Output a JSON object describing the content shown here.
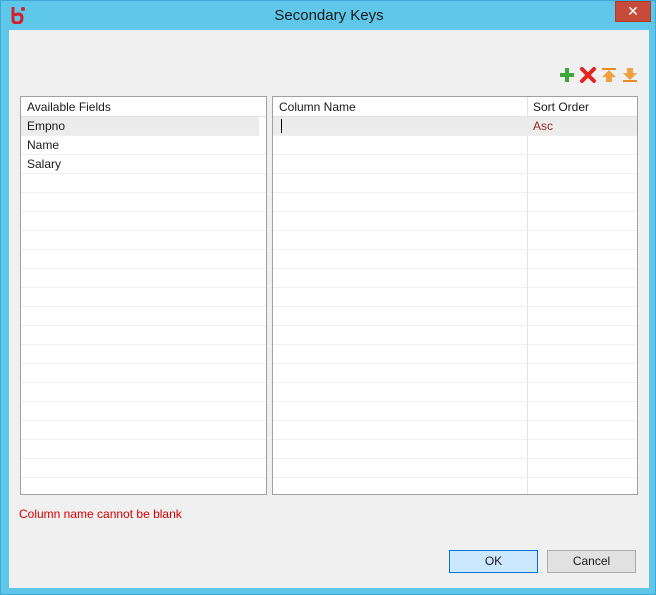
{
  "window": {
    "title": "Secondary Keys",
    "close_glyph": "✕"
  },
  "toolbar": {
    "icons": [
      "add-icon",
      "delete-icon",
      "move-up-icon",
      "move-down-icon"
    ]
  },
  "available_fields": {
    "header": "Available Fields",
    "items": [
      "Empno",
      "Name",
      "Salary"
    ],
    "selected": "Empno"
  },
  "keys_table": {
    "columns": [
      "Column Name",
      "Sort Order"
    ],
    "rows": [
      {
        "column_name": "",
        "sort_order": "Asc"
      }
    ]
  },
  "error": {
    "message": "Column name cannot be blank"
  },
  "buttons": {
    "ok": "OK",
    "cancel": "Cancel"
  },
  "colors": {
    "title_bar": "#5ec7ea",
    "error": "#d40000",
    "sort_order_text": "#9b2a1e",
    "ok_border": "#0078d7"
  }
}
